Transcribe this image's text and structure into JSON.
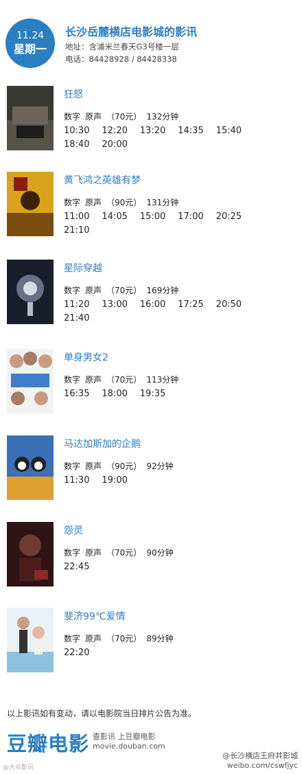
{
  "header": {
    "date": "11.24",
    "weekday": "星期一",
    "cinema_name": "长沙岳麓横店电影城的影讯",
    "address": "地址：含浦米兰春天G3号楼一层",
    "phone": "电话：84428928 / 84428338"
  },
  "movies": [
    {
      "title": "狂怒",
      "format": "数字",
      "audio": "原声",
      "price": "（70元）",
      "duration": "132分钟",
      "times": [
        "10:30",
        "12:20",
        "13:20",
        "14:35",
        "15:40",
        "18:40",
        "20:00"
      ]
    },
    {
      "title": "黄飞鸿之英雄有梦",
      "format": "数字",
      "audio": "原声",
      "price": "（90元）",
      "duration": "131分钟",
      "times": [
        "11:00",
        "14:05",
        "15:00",
        "17:00",
        "20:25",
        "21:10"
      ]
    },
    {
      "title": "星际穿越",
      "format": "数字",
      "audio": "原声",
      "price": "（70元）",
      "duration": "169分钟",
      "times": [
        "11:20",
        "13:00",
        "16:00",
        "17:25",
        "20:50",
        "21:40"
      ]
    },
    {
      "title": "单身男女2",
      "format": "数字",
      "audio": "原声",
      "price": "（70元）",
      "duration": "113分钟",
      "times": [
        "16:35",
        "18:00",
        "19:35"
      ]
    },
    {
      "title": "马达加斯加的企鹅",
      "format": "数字",
      "audio": "原声",
      "price": "（90元）",
      "duration": "92分钟",
      "times": [
        "11:30",
        "19:00"
      ]
    },
    {
      "title": "怨灵",
      "format": "数字",
      "audio": "原声",
      "price": "（70元）",
      "duration": "90分钟",
      "times": [
        "22:45"
      ]
    },
    {
      "title": "斐济99℃爱情",
      "format": "数字",
      "audio": "原声",
      "price": "（70元）",
      "duration": "89分钟",
      "times": [
        "22:20"
      ]
    }
  ],
  "footer": {
    "notice": "以上影讯如有变动，请以电影院当日排片公告为准。",
    "logo": "豆瓣电影",
    "sub1": "查影讯  上豆瓣电影",
    "sub2": "movie.douban.com",
    "watermark_left": "@大众影讯",
    "watermark_right1": "@长沙横店王府井影城",
    "watermark_right2": "weibo.com/cswfjyc"
  },
  "colors": {
    "accent": "#2b7ec1"
  },
  "icons": [
    "calendar-date-badge",
    "movie-poster"
  ]
}
